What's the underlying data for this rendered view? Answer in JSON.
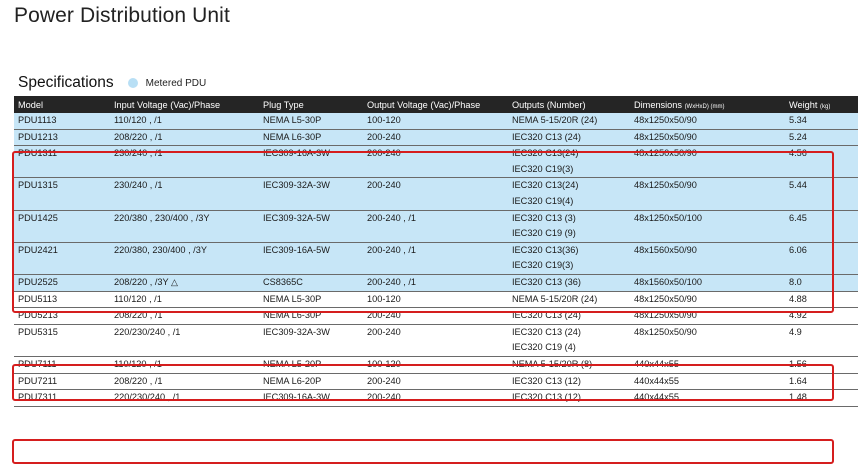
{
  "page": {
    "title": "Power Distribution Unit"
  },
  "specs": {
    "title": "Specifications",
    "legend_label": "Metered PDU",
    "legend_color": "#b8dff5",
    "columns": [
      {
        "label": "Model"
      },
      {
        "label": "Input Voltage (Vac)/Phase"
      },
      {
        "label": "Plug Type"
      },
      {
        "label": "Output Voltage (Vac)/Phase"
      },
      {
        "label": "Outputs (Number)"
      },
      {
        "label": "Dimensions",
        "unit": "(WxHxD) (mm)"
      },
      {
        "label": "Weight",
        "unit": "(kg)"
      }
    ],
    "rows": [
      {
        "model": "PDU1113",
        "input": "110/120 , /1",
        "plug": "NEMA L5-30P",
        "output": "100-120",
        "outputs": [
          "NEMA 5-15/20R (24)"
        ],
        "dims": "48x1250x50/90",
        "weight": "5.34",
        "metered": true
      },
      {
        "model": "PDU1213",
        "input": "208/220 , /1",
        "plug": "NEMA L6-30P",
        "output": "200-240",
        "outputs": [
          "IEC320 C13 (24)"
        ],
        "dims": "48x1250x50/90",
        "weight": "5.24",
        "metered": true
      },
      {
        "model": "PDU1311",
        "input": "230/240 , /1",
        "plug": "IEC309-16A-3W",
        "output": "200-240",
        "outputs": [
          "IEC320 C13(24)",
          "IEC320 C19(3)"
        ],
        "dims": "48x1250x50/90",
        "weight": "4.56",
        "metered": true
      },
      {
        "model": "PDU1315",
        "input": "230/240 , /1",
        "plug": "IEC309-32A-3W",
        "output": "200-240",
        "outputs": [
          "IEC320 C13(24)",
          "IEC320 C19(4)"
        ],
        "dims": "48x1250x50/90",
        "weight": "5.44",
        "metered": true
      },
      {
        "model": "PDU1425",
        "input": "220/380 , 230/400 , /3Y",
        "plug": "IEC309-32A-5W",
        "output": "200-240 , /1",
        "outputs": [
          "IEC320 C13 (3)",
          "IEC320 C19 (9)"
        ],
        "dims": "48x1250x50/100",
        "weight": "6.45",
        "metered": true
      },
      {
        "model": "PDU2421",
        "input": "220/380, 230/400 , /3Y",
        "plug": "IEC309-16A-5W",
        "output": "200-240 , /1",
        "outputs": [
          "IEC320 C13(36)",
          "IEC320 C19(3)"
        ],
        "dims": "48x1560x50/90",
        "weight": "6.06",
        "metered": true
      },
      {
        "model": "PDU2525",
        "input": "208/220 , /3Y △",
        "plug": "CS8365C",
        "output": "200-240 , /1",
        "outputs": [
          "IEC320 C13 (36)"
        ],
        "dims": "48x1560x50/100",
        "weight": "8.0",
        "metered": true
      },
      {
        "model": "PDU5113",
        "input": "110/120 , /1",
        "plug": "NEMA L5-30P",
        "output": "100-120",
        "outputs": [
          "NEMA 5-15/20R (24)"
        ],
        "dims": "48x1250x50/90",
        "weight": "4.88",
        "metered": false
      },
      {
        "model": "PDU5213",
        "input": "208/220 , /1",
        "plug": "NEMA L6-30P",
        "output": "200-240",
        "outputs": [
          "IEC320 C13 (24)"
        ],
        "dims": "48x1250x50/90",
        "weight": "4.92",
        "metered": false
      },
      {
        "model": "PDU5315",
        "input": "220/230/240 , /1",
        "plug": "IEC309-32A-3W",
        "output": "200-240",
        "outputs": [
          "IEC320 C13 (24)",
          "IEC320 C19 (4)"
        ],
        "dims": "48x1250x50/90",
        "weight": "4.9",
        "metered": false
      },
      {
        "model": "PDU7111",
        "input": "110/120 , /1",
        "plug": "NEMA L5-20P",
        "output": "100-120",
        "outputs": [
          "NEMA 5-15/20R (8)"
        ],
        "dims": "440x44x55",
        "weight": "1.56",
        "metered": false
      },
      {
        "model": "PDU7211",
        "input": "208/220 , /1",
        "plug": "NEMA L6-20P",
        "output": "200-240",
        "outputs": [
          "IEC320 C13 (12)"
        ],
        "dims": "440x44x55",
        "weight": "1.64",
        "metered": false
      },
      {
        "model": "PDU7311",
        "input": "220/230/240 , /1",
        "plug": "IEC309-16A-3W",
        "output": "200-240",
        "outputs": [
          "IEC320 C13 (12)"
        ],
        "dims": "440x44x55",
        "weight": "1.48",
        "metered": false
      }
    ]
  },
  "highlight_color": "#d51e1e"
}
